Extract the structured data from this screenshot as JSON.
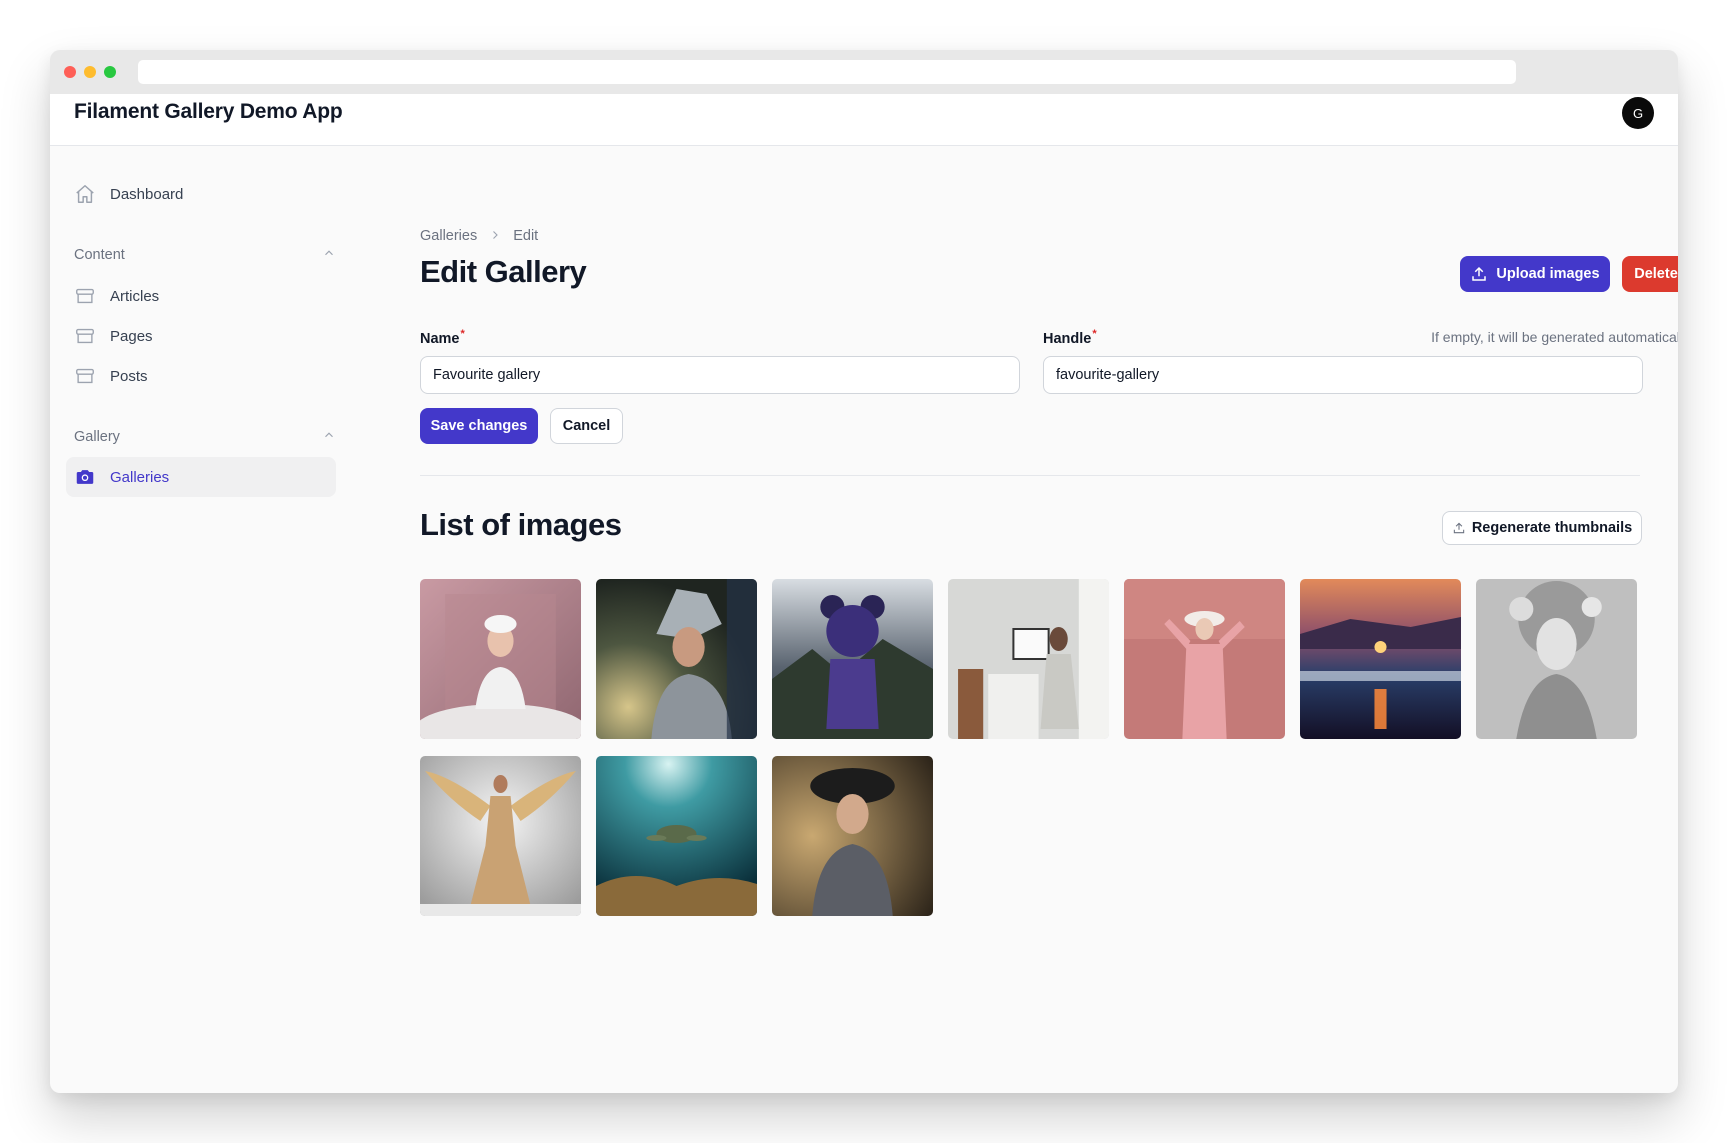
{
  "app": {
    "title": "Filament Gallery Demo App",
    "avatar_initial": "G"
  },
  "sidebar": {
    "dashboard": "Dashboard",
    "groups": [
      {
        "label": "Content",
        "items": [
          "Articles",
          "Pages",
          "Posts"
        ]
      },
      {
        "label": "Gallery",
        "items": [
          "Galleries"
        ]
      }
    ],
    "active_item": "Galleries"
  },
  "breadcrumb": {
    "parent": "Galleries",
    "current": "Edit"
  },
  "page": {
    "title": "Edit Gallery",
    "upload_label": "Upload images",
    "delete_label": "Delete"
  },
  "form": {
    "name_label": "Name",
    "name_value": "Favourite gallery",
    "handle_label": "Handle",
    "handle_value": "favourite-gallery",
    "handle_hint": "If empty, it will be generated automatically",
    "required_mark": "*",
    "save_label": "Save changes",
    "cancel_label": "Cancel"
  },
  "images_section": {
    "title": "List of images",
    "regenerate_label": "Regenerate thumbnails",
    "images": [
      "chef-portrait-pink",
      "crowned-queen",
      "teddy-head-figure",
      "woman-in-office",
      "woman-pink-wall",
      "sunset-sea",
      "silver-sculpture",
      "winged-woman",
      "sea-turtle",
      "woman-in-hat"
    ]
  },
  "colors": {
    "primary": "#4338ca",
    "danger": "#dc3a2e"
  }
}
